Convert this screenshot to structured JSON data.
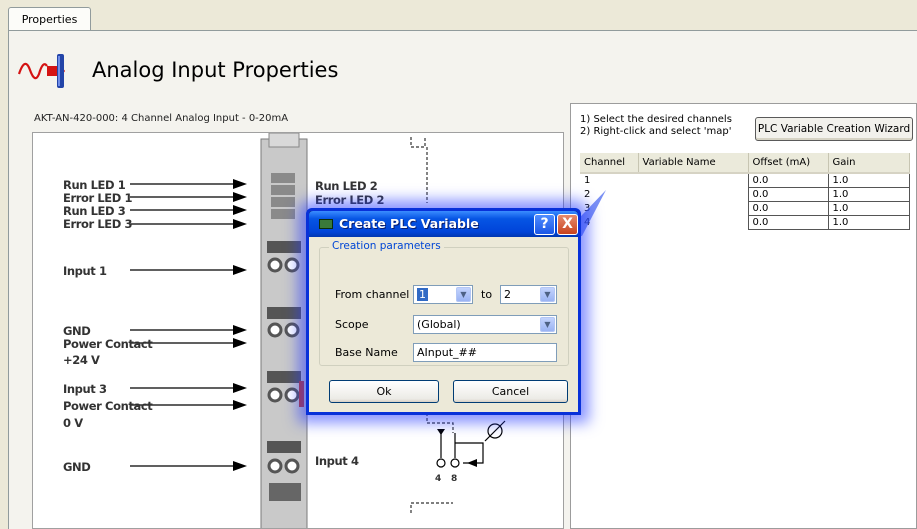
{
  "tab": {
    "label": "Properties"
  },
  "header": {
    "title": "Analog Input Properties",
    "icon": "analog-signal-icon"
  },
  "module": {
    "description": "AKT-AN-420-000: 4 Channel Analog Input - 0-20mA"
  },
  "diagram": {
    "left_labels": [
      "Run LED 1",
      "Error LED 1",
      "Run LED 3",
      "Error LED 3",
      "Input 1",
      "GND",
      "Power Contact",
      "+24 V",
      "Input 3",
      "Power Contact",
      "0 V",
      "GND"
    ],
    "right_labels": [
      "Run LED 2",
      "Error LED 2",
      "Input 4"
    ],
    "terminal_numbers": [
      "4",
      "8"
    ]
  },
  "wizard": {
    "instructions": [
      "1) Select the desired channels",
      "2) Right-click and select 'map'"
    ],
    "button_label": "PLC Variable Creation Wizard"
  },
  "channel_table": {
    "columns": [
      "Channel",
      "Variable Name",
      "Offset (mA)",
      "Gain"
    ],
    "rows": [
      {
        "channel": "1",
        "variable_name": "",
        "offset": "0.0",
        "gain": "1.0"
      },
      {
        "channel": "2",
        "variable_name": "",
        "offset": "0.0",
        "gain": "1.0"
      },
      {
        "channel": "3",
        "variable_name": "",
        "offset": "0.0",
        "gain": "1.0"
      },
      {
        "channel": "4",
        "variable_name": "",
        "offset": "0.0",
        "gain": "1.0"
      }
    ]
  },
  "dialog": {
    "title": "Create PLC Variable",
    "help_label": "?",
    "close_label": "X",
    "group_label": "Creation parameters",
    "from_channel_label": "From channel",
    "from_channel_value": "1",
    "to_label": "to",
    "to_value": "2",
    "scope_label": "Scope",
    "scope_value": "(Global)",
    "base_name_label": "Base Name",
    "base_name_value": "AInput_##",
    "ok_label": "Ok",
    "cancel_label": "Cancel"
  },
  "colors": {
    "accent": "#0831d9",
    "title_bar": "#0655e4",
    "close": "#c8421e",
    "group_label": "#0046d5"
  }
}
